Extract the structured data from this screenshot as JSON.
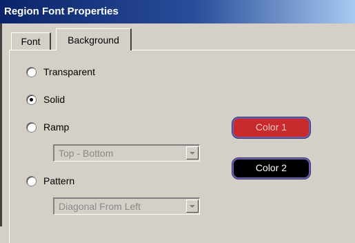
{
  "window": {
    "title": "Region Font Properties"
  },
  "tabs": [
    {
      "label": "Font",
      "selected": false
    },
    {
      "label": "Background",
      "selected": true
    }
  ],
  "background": {
    "options": [
      {
        "label": "Transparent",
        "checked": false
      },
      {
        "label": "Solid",
        "checked": true
      },
      {
        "label": "Ramp",
        "checked": false
      },
      {
        "label": "Pattern",
        "checked": false
      }
    ],
    "ramp_select": {
      "value": "Top - Bottom",
      "enabled": false
    },
    "pattern_select": {
      "value": "Diagonal From Left",
      "enabled": false
    },
    "color1": {
      "label": "Color 1",
      "color": "#c92a2a"
    },
    "color2": {
      "label": "Color 2",
      "color": "#000000"
    }
  },
  "colors": {
    "title_gradient_start": "#0a246a",
    "title_gradient_end": "#a6caf0",
    "dialog_bg": "#d4d0c8"
  }
}
